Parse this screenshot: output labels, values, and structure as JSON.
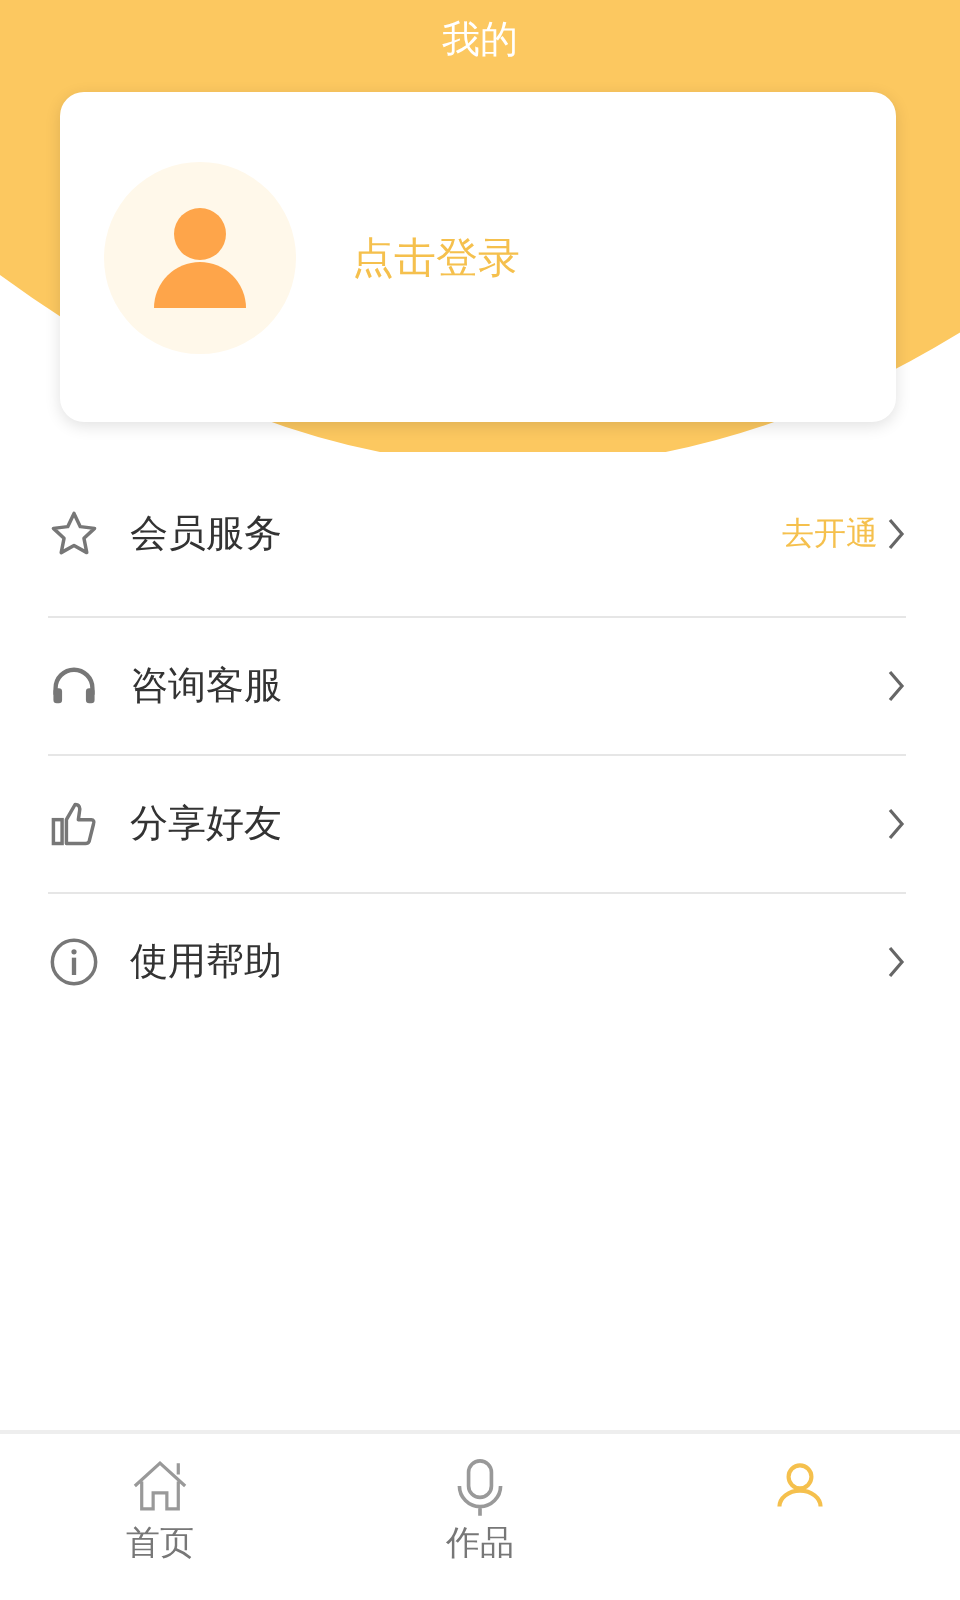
{
  "header": {
    "title": "我的"
  },
  "profile": {
    "login_label": "点击登录"
  },
  "menu": [
    {
      "kind": "star",
      "label": "会员服务",
      "action": "去开通"
    },
    {
      "kind": "headset",
      "label": "咨询客服"
    },
    {
      "kind": "thumb",
      "label": "分享好友"
    },
    {
      "kind": "info",
      "label": "使用帮助"
    }
  ],
  "tab_bar": [
    {
      "kind": "home",
      "label": "首页",
      "selected": false
    },
    {
      "kind": "mic",
      "label": "作品",
      "selected": false
    },
    {
      "kind": "person",
      "selected": true
    }
  ]
}
